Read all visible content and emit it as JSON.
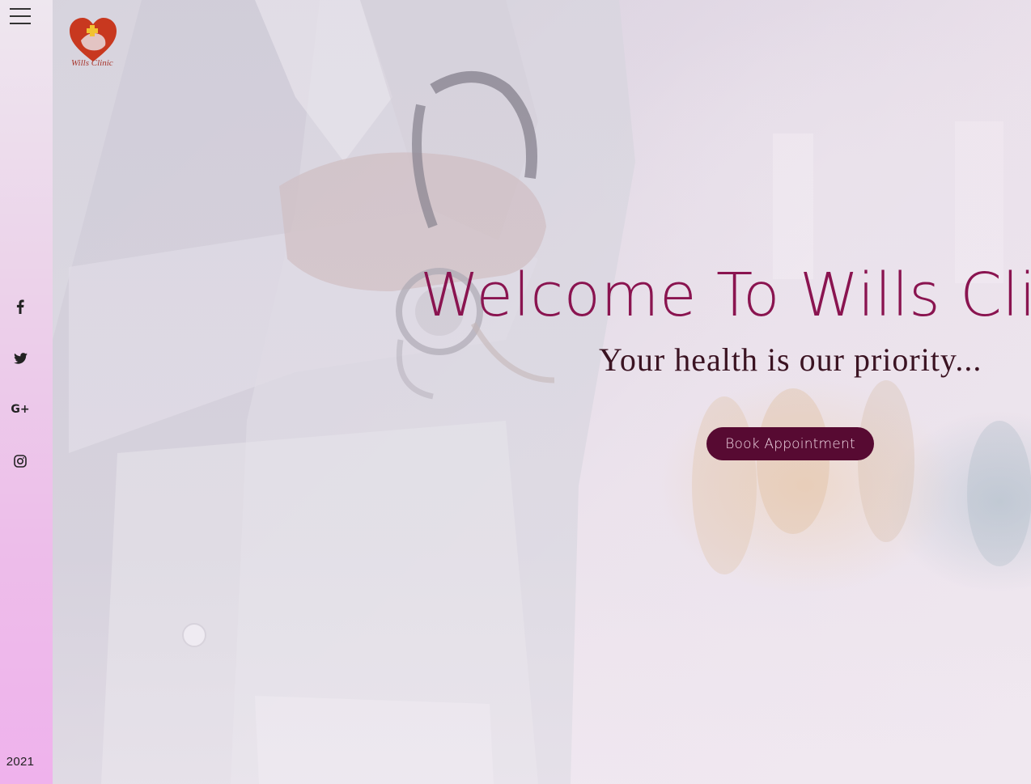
{
  "sidebar": {
    "year": "2021",
    "social": [
      {
        "name": "facebook-icon"
      },
      {
        "name": "twitter-icon"
      },
      {
        "name": "google-plus-icon",
        "label": "G+"
      },
      {
        "name": "instagram-icon"
      }
    ],
    "menu_icon": "hamburger-menu-icon"
  },
  "header": {
    "logo_text": "Wills Clinic"
  },
  "hero": {
    "title": "Welcome To Wills Clinic",
    "subtitle": "Your health is our priority...",
    "cta_label": "Book Appointment"
  },
  "colors": {
    "accent": "#8a1450",
    "button_bg": "#570a32",
    "button_text": "#f2d9e6",
    "sidebar_top": "#eee7ef",
    "sidebar_bottom": "#efb2ec"
  }
}
